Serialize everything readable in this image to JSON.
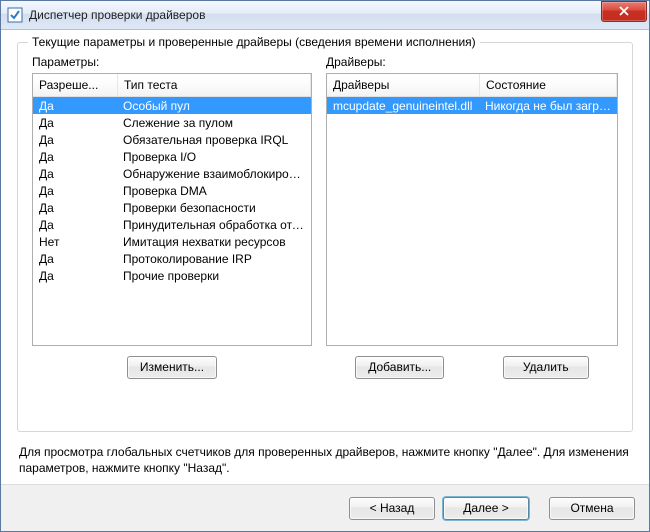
{
  "window": {
    "title": "Диспетчер проверки драйверов"
  },
  "group": {
    "heading": "Текущие параметры и проверенные драйверы (сведения времени исполнения)",
    "params_label": "Параметры:",
    "drivers_label": "Драйверы:"
  },
  "params_columns": {
    "enabled": "Разреше...",
    "test": "Тип теста"
  },
  "drivers_columns": {
    "driver": "Драйверы",
    "state": "Состояние"
  },
  "params_rows": [
    {
      "enabled": "Да",
      "test": "Особый пул",
      "selected": true
    },
    {
      "enabled": "Да",
      "test": "Слежение за пулом"
    },
    {
      "enabled": "Да",
      "test": "Обязательная проверка IRQL"
    },
    {
      "enabled": "Да",
      "test": "Проверка I/O"
    },
    {
      "enabled": "Да",
      "test": "Обнаружение взаимоблокировок"
    },
    {
      "enabled": "Да",
      "test": "Проверка DMA"
    },
    {
      "enabled": "Да",
      "test": "Проверки безопасности"
    },
    {
      "enabled": "Да",
      "test": "Принудительная обработка отложен..."
    },
    {
      "enabled": "Нет",
      "test": "Имитация нехватки ресурсов"
    },
    {
      "enabled": "Да",
      "test": "Протоколирование IRP"
    },
    {
      "enabled": "Да",
      "test": "Прочие проверки"
    }
  ],
  "drivers_rows": [
    {
      "driver": "mcupdate_genuineintel.dll",
      "state": "Никогда не был загру...",
      "selected": true
    }
  ],
  "buttons": {
    "change": "Изменить...",
    "add": "Добавить...",
    "remove": "Удалить"
  },
  "helper": "Для просмотра глобальных счетчиков для проверенных драйверов, нажмите кнопку \"Далее\". Для изменения параметров, нажмите кнопку \"Назад\".",
  "footer": {
    "back": "< Назад",
    "next": "Далее >",
    "cancel": "Отмена"
  }
}
